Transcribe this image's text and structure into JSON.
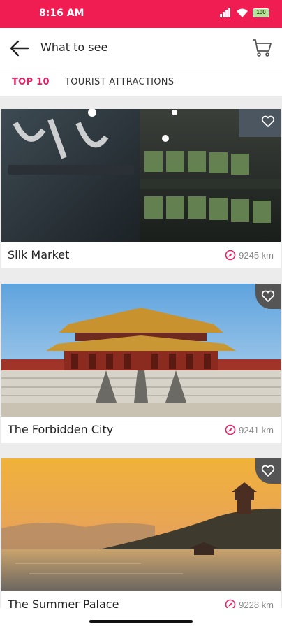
{
  "status_bar": {
    "time": "8:16 AM",
    "battery": "100"
  },
  "header": {
    "title": "What to see",
    "back_icon": "arrow-left-icon",
    "cart_icon": "cart-icon"
  },
  "tabs": [
    {
      "label": "TOP 10",
      "active": true
    },
    {
      "label": "TOURIST ATTRACTIONS",
      "active": false
    }
  ],
  "places": [
    {
      "name": "Silk Market",
      "distance": "9245 km"
    },
    {
      "name": "The Forbidden City",
      "distance": "9241 km"
    },
    {
      "name": "The Summer Palace",
      "distance": "9228 km"
    }
  ],
  "colors": {
    "accent": "#ef1d52",
    "tab_active": "#e91e63"
  }
}
